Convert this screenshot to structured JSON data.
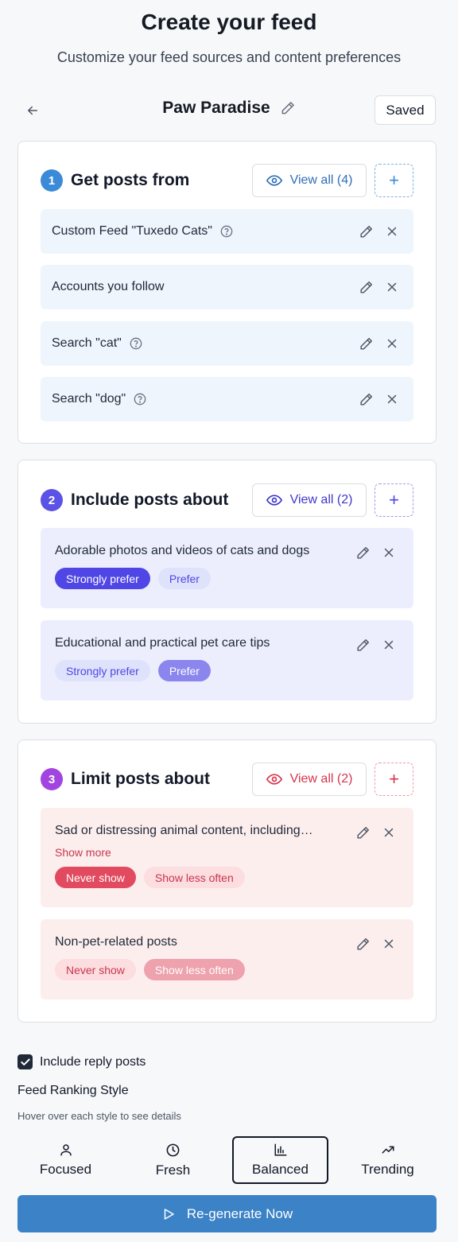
{
  "header": {
    "title": "Create your feed",
    "subtitle": "Customize your feed sources and content preferences"
  },
  "toolbar": {
    "feed_name": "Paw Paradise",
    "saved_label": "Saved"
  },
  "sources": {
    "title": "Get posts from",
    "number": "1",
    "view_all_label": "View all (4)",
    "accent": "#3b8ad8",
    "items": [
      {
        "label": "Custom Feed \"Tuxedo Cats\"",
        "help": true
      },
      {
        "label": "Accounts you follow",
        "help": false
      },
      {
        "label": "Search \"cat\"",
        "help": true
      },
      {
        "label": "Search \"dog\"",
        "help": true
      }
    ]
  },
  "include": {
    "title": "Include posts about",
    "number": "2",
    "view_all_label": "View all (2)",
    "accent": "#4f46e5",
    "items": [
      {
        "label": "Adorable photos and videos of cats and dogs",
        "strong_label": "Strongly prefer",
        "prefer_label": "Prefer",
        "selected": "strong"
      },
      {
        "label": "Educational and practical pet care tips",
        "strong_label": "Strongly prefer",
        "prefer_label": "Prefer",
        "selected": "prefer"
      }
    ]
  },
  "limit": {
    "title": "Limit posts about",
    "number": "3",
    "view_all_label": "View all (2)",
    "accent": "#dc3a52",
    "items": [
      {
        "label": "Sad or distressing animal content, including…",
        "show_more": "Show more",
        "never_label": "Never show",
        "less_label": "Show less often",
        "selected": "never"
      },
      {
        "label": "Non-pet-related posts",
        "never_label": "Never show",
        "less_label": "Show less often",
        "selected": "less"
      }
    ]
  },
  "options": {
    "include_replies_label": "Include reply posts",
    "include_replies_checked": true,
    "ranking_title": "Feed Ranking Style",
    "ranking_hint": "Hover over each style to see details",
    "styles": [
      {
        "label": "Focused",
        "icon": "person-icon"
      },
      {
        "label": "Fresh",
        "icon": "clock-icon"
      },
      {
        "label": "Balanced",
        "icon": "bar-chart-icon"
      },
      {
        "label": "Trending",
        "icon": "trending-up-icon"
      }
    ],
    "selected_style": "Balanced"
  },
  "action": {
    "regenerate_label": "Re-generate Now"
  }
}
